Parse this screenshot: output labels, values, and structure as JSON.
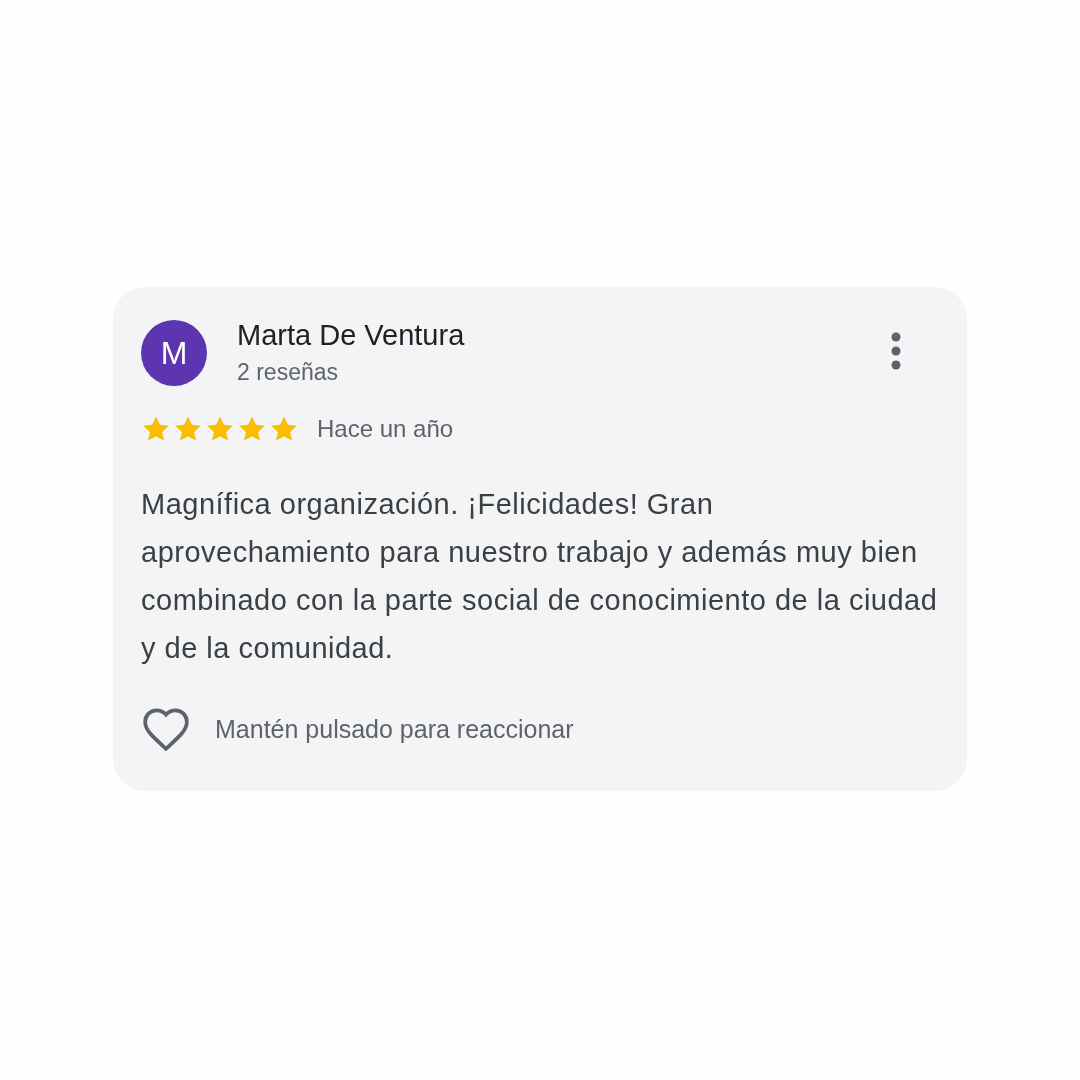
{
  "review": {
    "avatar_letter": "M",
    "author": "Marta De Ventura",
    "review_count": "2 reseñas",
    "stars": 5,
    "time": "Hace un año",
    "text": "Magnífica organización. ¡Felicidades! Gran aprovechamiento para nuestro trabajo y además muy bien combinado con la parte social de conocimiento de la ciudad y de la comunidad.",
    "reaction_hint": "Mantén pulsado para reaccionar"
  }
}
